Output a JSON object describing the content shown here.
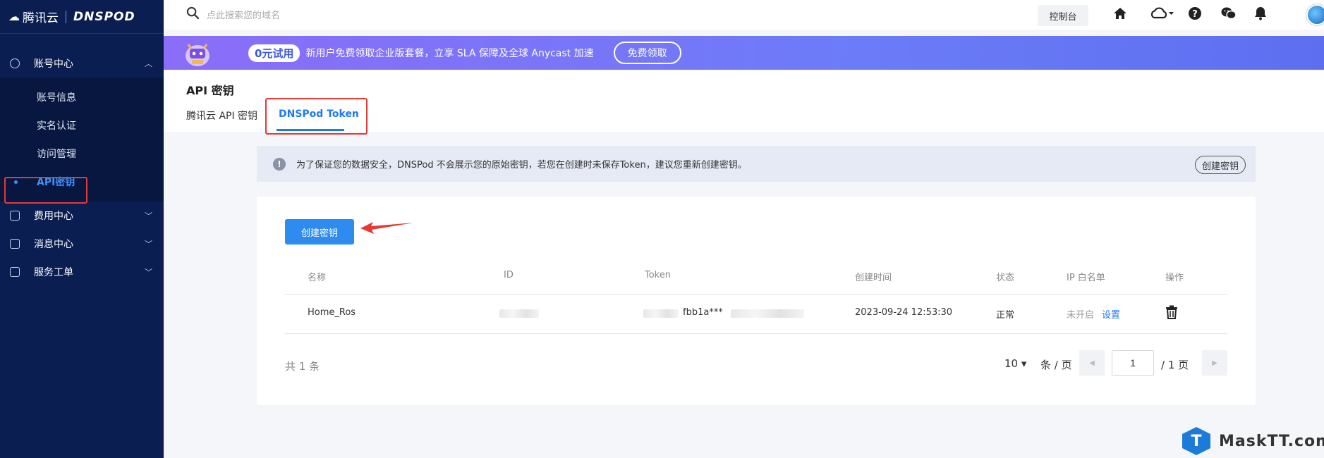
{
  "brand": {
    "tencent": "腾讯云",
    "dnspod": "DNSPOD"
  },
  "sidebar": {
    "groups": [
      {
        "label": "账号中心",
        "items": [
          "账号信息",
          "实名认证",
          "访问管理",
          "API密钥"
        ]
      },
      {
        "label": "费用中心"
      },
      {
        "label": "消息中心"
      },
      {
        "label": "服务工单"
      }
    ]
  },
  "topbar": {
    "search_placeholder": "点此搜索您的域名",
    "console_label": "控制台",
    "icons": [
      "home-icon",
      "cloud-icon",
      "help-icon",
      "wechat-icon",
      "bell-icon"
    ]
  },
  "banner": {
    "badge": "0元试用",
    "text": "新用户免费领取企业版套餐，立享 SLA 保障及全球 Anycast 加速",
    "button": "免费领取"
  },
  "page": {
    "title": "API 密钥",
    "tabs": [
      {
        "label": "腾讯云 API 密钥",
        "active": false
      },
      {
        "label": "DNSPod Token",
        "active": true
      }
    ]
  },
  "notice": {
    "text": "为了保证您的数据安全，DNSPod 不会展示您的原始密钥，若您在创建时未保存Token，建议您重新创建密钥。",
    "button": "创建密钥"
  },
  "card": {
    "create_button": "创建密钥",
    "columns": [
      "名称",
      "ID",
      "Token",
      "创建时间",
      "状态",
      "IP 白名单",
      "操作"
    ],
    "rows": [
      {
        "name": "Home_Ros",
        "token_visible": "fbb1a***",
        "created": "2023-09-24 12:53:30",
        "status": "正常",
        "ip_whitelist": "未开启",
        "ip_action": "设置"
      }
    ]
  },
  "pagination": {
    "total": "共 1 条",
    "page_size": "10 ▾",
    "per_page": "条 / 页",
    "current": "1",
    "total_pages": "/ 1 页"
  },
  "watermark": {
    "logo": "T",
    "text": "MaskTT.com"
  },
  "colors": {
    "sidebar": "#0b1e52",
    "accent": "#1e78f0",
    "highlight": "#e53935",
    "banner": "#6c7cf7"
  }
}
